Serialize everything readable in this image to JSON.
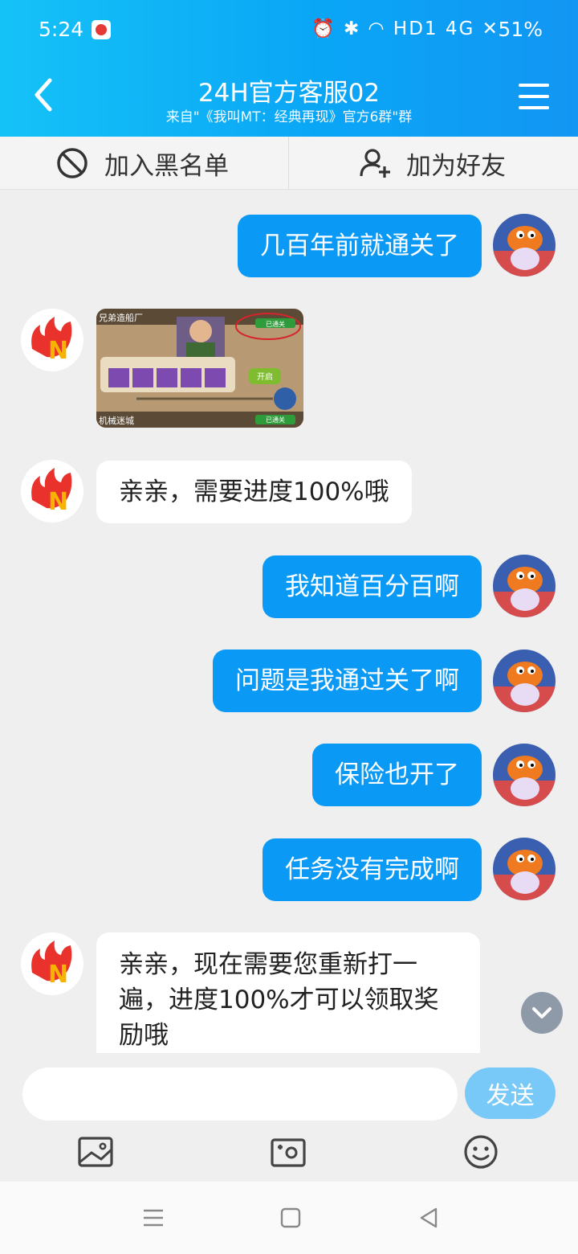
{
  "status_bar": {
    "time": "5:24",
    "indicators": "⏰ ✱ ◠ HD1 4G ✕",
    "battery": "51%"
  },
  "header": {
    "title": "24H官方客服02",
    "subtitle": "来自\"《我叫MT：经典再现》官方6群\"群"
  },
  "actions": {
    "blacklist_label": "加入黑名单",
    "add_friend_label": "加为好友"
  },
  "messages": [
    {
      "side": "me",
      "text": "几百年前就通关了"
    },
    {
      "side": "them",
      "type": "image"
    },
    {
      "side": "them",
      "text": "亲亲，需要进度100%哦"
    },
    {
      "side": "me",
      "text": "我知道百分百啊"
    },
    {
      "side": "me",
      "text": "问题是我通过关了啊"
    },
    {
      "side": "me",
      "text": "保险也开了"
    },
    {
      "side": "me",
      "text": "任务没有完成啊"
    },
    {
      "side": "them",
      "text": "亲亲，现在需要您重新打一遍，进度100%才可以领取奖励哦"
    }
  ],
  "screenshot_msg": {
    "title": "兄弟造船厂",
    "badge": "已通关",
    "open_button": "开启",
    "title2": "机械迷城",
    "badge2": "已通关"
  },
  "input": {
    "placeholder": "",
    "send_label": "发送"
  },
  "colors": {
    "header_start": "#15c2f7",
    "header_end": "#1296f3",
    "my_bubble": "#0a99f5",
    "send_disabled": "#79c9f8"
  }
}
